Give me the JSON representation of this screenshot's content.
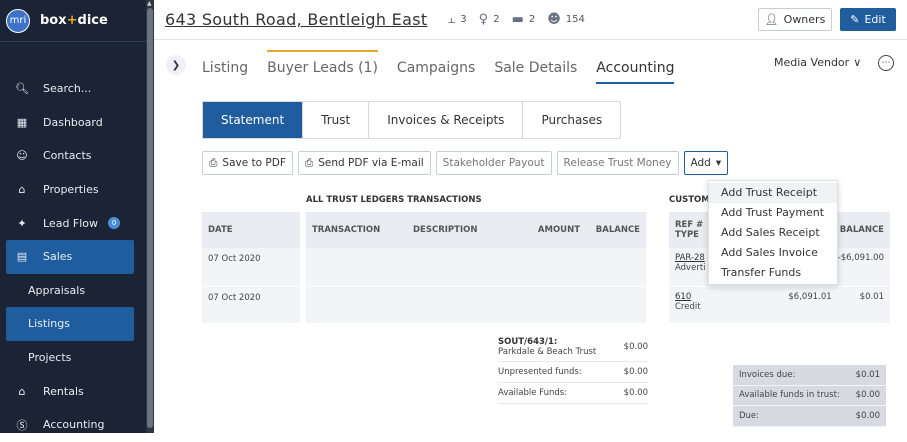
{
  "brand": {
    "logo_text": "mri",
    "name_part1": "box",
    "name_plus": "+",
    "name_part2": "dice"
  },
  "sidebar": {
    "items": [
      {
        "label": "Search...",
        "icon": "search-icon"
      },
      {
        "label": "Dashboard",
        "icon": "dashboard-icon"
      },
      {
        "label": "Contacts",
        "icon": "contacts-icon"
      },
      {
        "label": "Properties",
        "icon": "properties-icon"
      },
      {
        "label": "Lead Flow",
        "icon": "lead-flow-icon",
        "badge": "0"
      },
      {
        "label": "Sales",
        "icon": "sales-icon"
      },
      {
        "label": "Appraisals"
      },
      {
        "label": "Listings"
      },
      {
        "label": "Projects"
      },
      {
        "label": "Rentals",
        "icon": "rentals-icon"
      },
      {
        "label": "Accounting",
        "icon": "accounting-icon"
      }
    ]
  },
  "header": {
    "address": "643 South Road, Bentleigh East",
    "bedrooms": "3",
    "bathrooms": "2",
    "cars": "2",
    "contacts": "154",
    "owners_label": "Owners",
    "edit_label": "Edit"
  },
  "tabs": [
    "Listing",
    "Buyer Leads (1)",
    "Campaigns",
    "Sale Details",
    "Accounting"
  ],
  "vendor_select": "Media Vendor",
  "segments": [
    "Statement",
    "Trust",
    "Invoices & Receipts",
    "Purchases"
  ],
  "actions": {
    "save_pdf": "Save to PDF",
    "send_pdf": "Send PDF via E-mail",
    "stakeholder_payout": "Stakeholder Payout",
    "release_trust": "Release Trust Money",
    "add": "Add"
  },
  "add_menu": [
    "Add Trust Receipt",
    "Add Trust Payment",
    "Add Sales Receipt",
    "Add Sales Invoice",
    "Transfer Funds"
  ],
  "left_table": {
    "header": "DATE",
    "rows": [
      "07 Oct 2020",
      "07 Oct 2020"
    ]
  },
  "trust_ledger": {
    "title": "ALL TRUST LEDGERS TRANSACTIONS",
    "columns": [
      "TRANSACTION",
      "DESCRIPTION",
      "AMOUNT",
      "BALANCE"
    ],
    "account_code": "SOUT/643/1:",
    "account_name": "Parkdale & Beach Trust",
    "account_amount": "$0.00",
    "unpresented_label": "Unpresented funds:",
    "unpresented_value": "$0.00",
    "available_label": "Available Funds:",
    "available_value": "$0.00"
  },
  "customer_ledger": {
    "title": "CUSTOM",
    "ref_header_1": "REF #",
    "ref_header_2": "TYPE",
    "balance_header": "BALANCE",
    "rows": [
      {
        "ref": "PAR-28",
        "type": "Adverti",
        "amount": "",
        "balance": "-$6,091.00"
      },
      {
        "ref": "610",
        "type": "Credit",
        "amount": "$6,091.01",
        "balance": "$0.01"
      }
    ]
  },
  "totals": [
    {
      "label": "Invoices due:",
      "value": "$0.01"
    },
    {
      "label": "Available funds in trust:",
      "value": "$0.00"
    },
    {
      "label": "Due:",
      "value": "$0.00"
    }
  ]
}
